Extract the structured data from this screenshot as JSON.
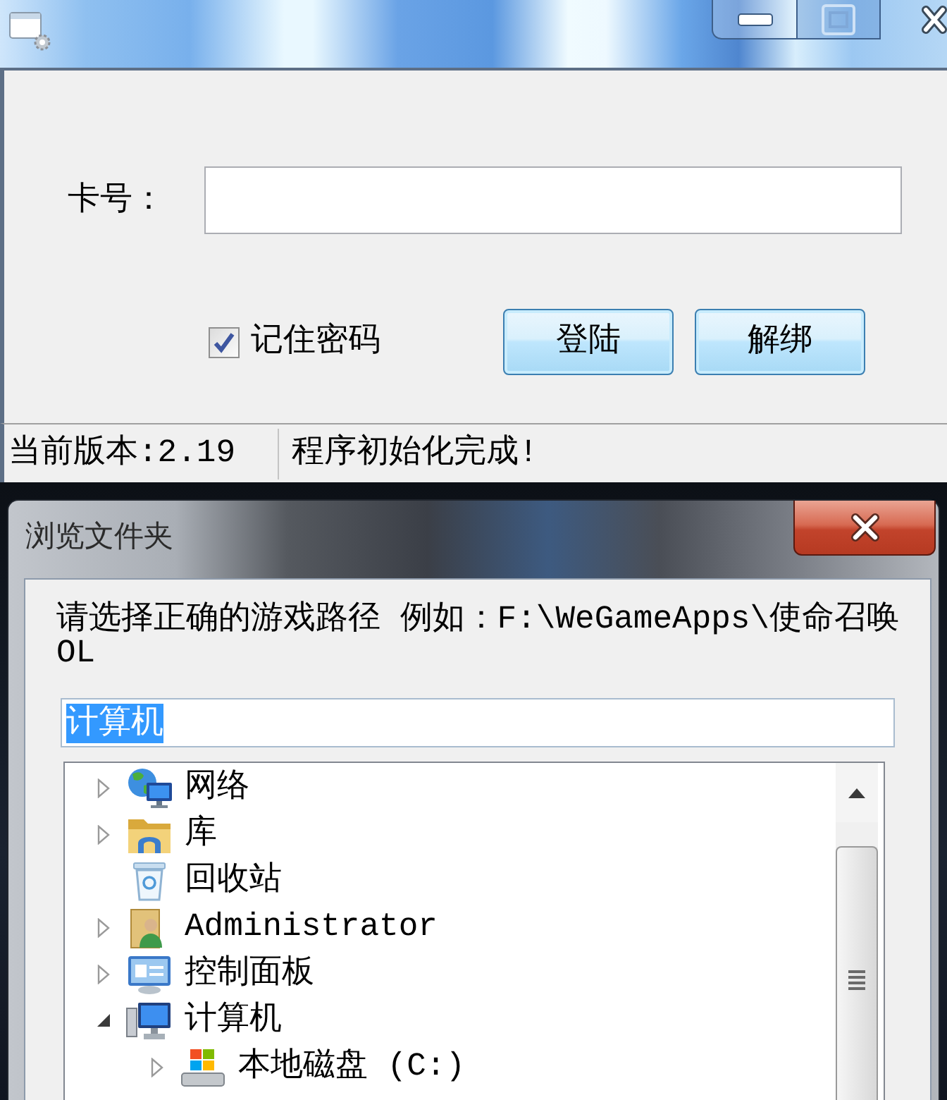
{
  "login_window": {
    "card_number": {
      "label": "卡号："
    },
    "remember_password": {
      "label": "记住密码",
      "checked": true
    },
    "buttons": [
      "登陆",
      "解绑"
    ],
    "status_bar": [
      "当前版本:2.19",
      "程序初始化完成!"
    ]
  },
  "browse_dialog": {
    "title": "浏览文件夹",
    "instruction": "请选择正确的游戏路径 例如：F:\\WeGameApps\\使命召唤OL",
    "folder_field": {
      "value": "计算机",
      "text_selected": true
    },
    "tree": [
      {
        "label": "网络",
        "kind": "network",
        "expanded": false
      },
      {
        "label": "库",
        "kind": "library",
        "expanded": false
      },
      {
        "label": "回收站",
        "kind": "recyclebin"
      },
      {
        "label": "Administrator",
        "kind": "userfolder",
        "expanded": false
      },
      {
        "label": "控制面板",
        "kind": "controlpanel",
        "expanded": false
      },
      {
        "label": "计算机",
        "kind": "computer",
        "expanded": true,
        "children": [
          {
            "label": "本地磁盘 (C:)",
            "kind": "drive",
            "expanded": false
          }
        ]
      }
    ]
  }
}
